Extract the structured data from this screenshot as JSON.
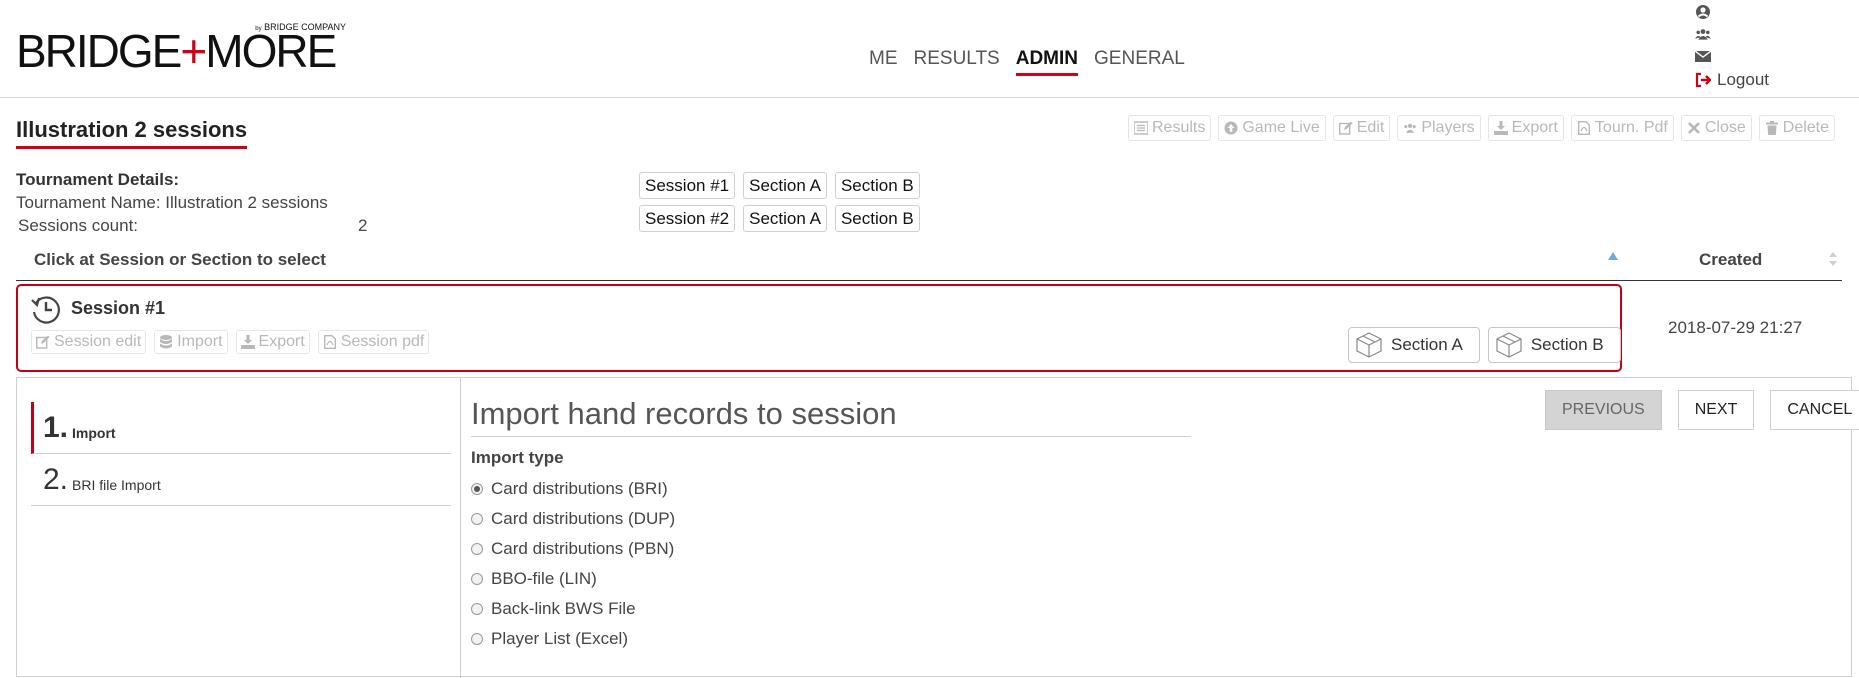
{
  "brand": {
    "main_left": "BRIDGE",
    "plus": "+",
    "main_right": "MORE",
    "sub_by": "by",
    "sub": "BRIDGE COMPANY"
  },
  "nav": {
    "items": [
      "ME",
      "RESULTS",
      "ADMIN",
      "GENERAL"
    ],
    "active": "ADMIN"
  },
  "user_menu": {
    "logout_label": "Logout"
  },
  "page": {
    "title": "Illustration 2 sessions"
  },
  "toolbar": {
    "results": "Results",
    "game_live": "Game Live",
    "edit": "Edit",
    "players": "Players",
    "export": "Export",
    "tourn_pdf": "Tourn. Pdf",
    "close": "Close",
    "delete": "Delete"
  },
  "details": {
    "heading": "Tournament Details:",
    "name_line": "Tournament Name: Illustration 2 sessions",
    "sessions_label": "Sessions count:",
    "sessions_value": "2"
  },
  "session_chips": [
    {
      "session": "Session #1",
      "sections": [
        "Section A",
        "Section B"
      ]
    },
    {
      "session": "Session #2",
      "sections": [
        "Section A",
        "Section B"
      ]
    }
  ],
  "table": {
    "col_left": "Click at Session or Section to select",
    "col_created": "Created"
  },
  "session_row": {
    "name": "Session #1",
    "actions": {
      "edit": "Session edit",
      "import": "Import",
      "export": "Export",
      "pdf": "Session pdf"
    },
    "sections": [
      "Section A",
      "Section B"
    ],
    "created": "2018-07-29 21:27"
  },
  "wizard": {
    "steps": [
      {
        "num": "1.",
        "label": "Import"
      },
      {
        "num": "2.",
        "label": "BRI file Import"
      }
    ],
    "title": "Import hand records to session",
    "import_type_label": "Import type",
    "options": [
      "Card distributions (BRI)",
      "Card distributions (DUP)",
      "Card distributions (PBN)",
      "BBO-file (LIN)",
      "Back-link BWS File",
      "Player List (Excel)"
    ],
    "selected_index": 0,
    "buttons": {
      "previous": "PREVIOUS",
      "next": "NEXT",
      "cancel": "CANCEL"
    }
  },
  "colors": {
    "accent": "#d0021b",
    "frame": "#c00018",
    "disabled_text": "#b8b8b8"
  }
}
